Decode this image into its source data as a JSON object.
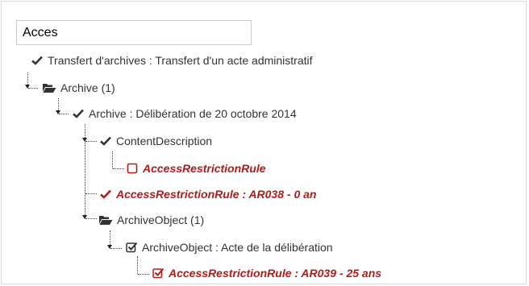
{
  "search": {
    "value": "Acces"
  },
  "tree": {
    "n0": {
      "label": "Transfert d'archives : Transfert d'un acte administratif",
      "icon": "check-icon"
    },
    "n1": {
      "label": "Archive (1)",
      "icon": "folder-open-icon"
    },
    "n2": {
      "label": "Archive : Délibération de 20 octobre 2014",
      "icon": "check-icon"
    },
    "n3": {
      "label": "ContentDescription",
      "icon": "check-icon"
    },
    "n4": {
      "label": "AccessRestrictionRule",
      "icon": "empty-checkbox-icon"
    },
    "n5": {
      "label": "AccessRestrictionRule : AR038 - 0 an",
      "icon": "check-icon"
    },
    "n6": {
      "label": "ArchiveObject (1)",
      "icon": "folder-open-icon"
    },
    "n7": {
      "label": "ArchiveObject : Acte de la délibération",
      "icon": "checked-checkbox-icon"
    },
    "n8": {
      "label": "AccessRestrictionRule : AR039 - 25 ans",
      "icon": "checked-checkbox-icon"
    }
  },
  "colors": {
    "rule_text": "#b31b1b",
    "normal_text": "#333333",
    "icon_dark": "#333333"
  }
}
